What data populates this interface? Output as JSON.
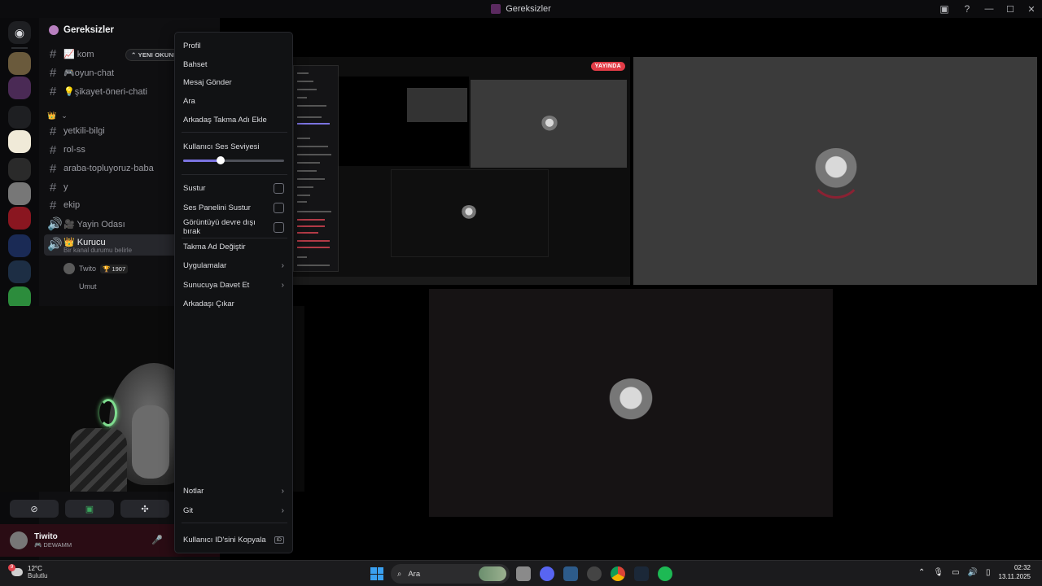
{
  "window": {
    "title": "Gereksizler"
  },
  "server": {
    "name": "Gereksizler"
  },
  "unread_pill": "YENI OKUNMAMIŞLAR",
  "channels": [
    {
      "icon": "#",
      "label": "📈 kom"
    },
    {
      "icon": "#",
      "label": "🎮oyun-chat"
    },
    {
      "icon": "#",
      "label": "💡şikayet-öneri-chati"
    },
    {
      "icon": "#",
      "label": "yetkili-bilgi"
    },
    {
      "icon": "#",
      "label": "rol-ss"
    },
    {
      "icon": "#",
      "label": "araba-topluyoruz-baba"
    },
    {
      "icon": "#",
      "label": "y"
    },
    {
      "icon": "#",
      "label": "ekip"
    }
  ],
  "voice_channels": {
    "stage": "🎥 Yayin Odası",
    "active": "👑 Kurucu",
    "active_sub": "Bir kanal durumu belirle",
    "users": [
      {
        "name": "Twito",
        "badge": "🏆 1907"
      },
      {
        "name": "Umut",
        "badge": ""
      }
    ]
  },
  "user_panel": {
    "name": "Tiwito",
    "status": "🎮 DEWAMM"
  },
  "context_menu": {
    "profile": "Profil",
    "mention": "Bahset",
    "message": "Mesaj Gönder",
    "call": "Ara",
    "add_nickname": "Arkadaş Takma Adı Ekle",
    "volume_label": "Kullanıcı Ses Seviyesi",
    "volume_level": 0.37,
    "mute": "Sustur",
    "mute_soundboard": "Ses Panelini Sustur",
    "disable_video": "Görüntüyü devre dışı bırak",
    "change_nickname": "Takma Ad Değiştir",
    "apps": "Uygulamalar",
    "invite": "Sunucuya Davet Et",
    "remove_friend": "Arkadaşı Çıkar",
    "notes_partial": "Notlar",
    "go": "Git",
    "copy_id": "Kullanıcı ID'sini Kopyala",
    "id_badge": "ID"
  },
  "stream": {
    "live_label": "YAYINDA"
  },
  "taskbar": {
    "weather_badge": "9",
    "temperature": "12°C",
    "weather": "Bulutlu",
    "search_placeholder": "Ara",
    "time": "02:32",
    "date": "13.11.2025"
  },
  "colors": {
    "accent": "#5865f2",
    "live_red": "#e23c47",
    "volume_fill": "#7b73e0",
    "active_green": "#3ba55d"
  }
}
